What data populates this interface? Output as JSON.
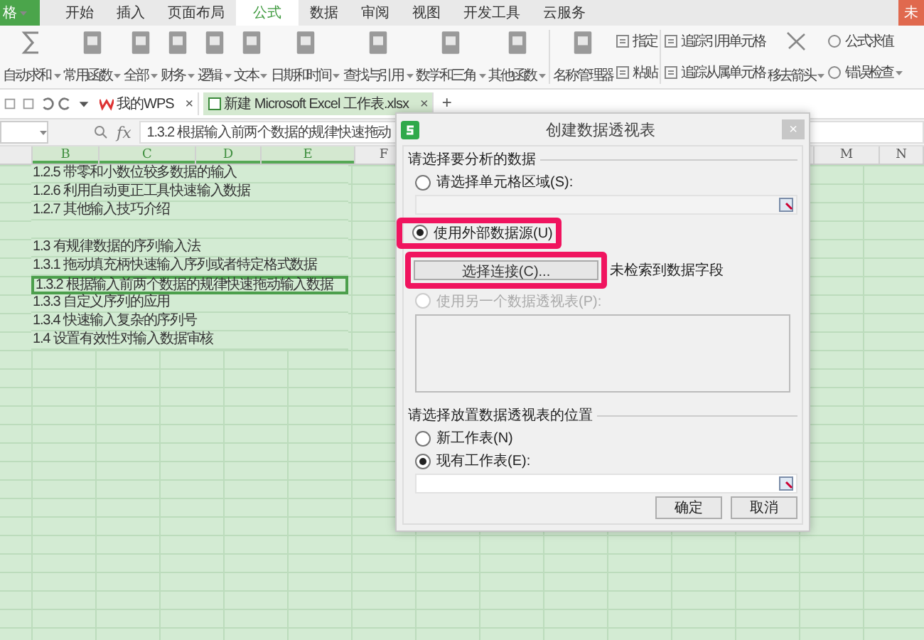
{
  "app_button": {
    "label": "格"
  },
  "menu_tabs": [
    {
      "label": "开始",
      "selected": false
    },
    {
      "label": "插入",
      "selected": false
    },
    {
      "label": "页面布局",
      "selected": false
    },
    {
      "label": "公式",
      "selected": true
    },
    {
      "label": "数据",
      "selected": false
    },
    {
      "label": "审阅",
      "selected": false
    },
    {
      "label": "视图",
      "selected": false
    },
    {
      "label": "开发工具",
      "selected": false
    },
    {
      "label": "云服务",
      "selected": false
    }
  ],
  "account_button": {
    "label": "未"
  },
  "ribbon": {
    "functions": [
      {
        "label": "自动求和",
        "dropdown": true
      },
      {
        "label": "常用函数",
        "dropdown": true
      },
      {
        "label": "全部",
        "dropdown": true
      },
      {
        "label": "财务",
        "dropdown": true
      },
      {
        "label": "逻辑",
        "dropdown": true
      },
      {
        "label": "文本",
        "dropdown": true
      },
      {
        "label": "日期和时间",
        "dropdown": true
      },
      {
        "label": "查找与引用",
        "dropdown": true
      },
      {
        "label": "数学和三角",
        "dropdown": true
      },
      {
        "label": "其他函数",
        "dropdown": true
      }
    ],
    "names": {
      "label": "名称管理器"
    },
    "name_actions": [
      {
        "label": "指定"
      },
      {
        "label": "粘贴"
      }
    ],
    "trace": [
      {
        "label": "追踪引用单元格"
      },
      {
        "label": "追踪从属单元格"
      }
    ],
    "remove_arrows": {
      "label": "移去箭头",
      "dropdown": true
    },
    "audit": [
      {
        "label": "公式求值",
        "dropdown": false
      },
      {
        "label": "错误检查",
        "dropdown": true
      }
    ]
  },
  "doc_tabs": [
    {
      "label": "我的WPS",
      "selected": false,
      "close": "×"
    },
    {
      "label": "新建 Microsoft Excel 工作表.xlsx",
      "selected": true,
      "close": "×"
    }
  ],
  "new_tab": "+",
  "formula_bar": {
    "fx": "fx",
    "value": "1.3.2 根据输入前两个数据的规律快速拖动"
  },
  "columns": [
    {
      "label": "B",
      "selected": true
    },
    {
      "label": "C",
      "selected": true
    },
    {
      "label": "D",
      "selected": true
    },
    {
      "label": "E",
      "selected": true
    },
    {
      "label": "F",
      "selected": false
    },
    {
      "label": "M",
      "selected": false
    },
    {
      "label": "N",
      "selected": false
    }
  ],
  "rows": [
    {
      "text": "1.2.5 带零和小数位较多数据的输入",
      "selected": false
    },
    {
      "text": "1.2.6 利用自动更正工具快速输入数据",
      "selected": false
    },
    {
      "text": "1.2.7 其他输入技巧介绍",
      "selected": false
    },
    {
      "text": "",
      "selected": false
    },
    {
      "text": "1.3 有规律数据的序列输入法",
      "selected": false
    },
    {
      "text": "1.3.1 拖动填充柄快速输入序列或者特定格式数据",
      "selected": false
    },
    {
      "text": "1.3.2 根据输入前两个数据的规律快速拖动输入数据",
      "selected": true
    },
    {
      "text": "1.3.3 自定义序列的应用",
      "selected": false
    },
    {
      "text": "1.3.4 快速输入复杂的序列号",
      "selected": false
    },
    {
      "text": "1.4 设置有效性对输入数据审核",
      "selected": false
    }
  ],
  "dialog": {
    "title": "创建数据透视表",
    "close": "×",
    "source_heading": "请选择要分析的数据",
    "source_options": [
      {
        "label": "请选择单元格区域(S):",
        "selected": false,
        "disabled": false,
        "highlighted": false
      },
      {
        "label": "使用外部数据源(U)",
        "selected": true,
        "disabled": false,
        "highlighted": true
      },
      {
        "label": "使用另一个数据透视表(P):",
        "selected": false,
        "disabled": true,
        "highlighted": false
      }
    ],
    "connection_button": {
      "label": "选择连接(C)...",
      "highlighted": true
    },
    "connection_note": "未检索到数据字段",
    "location_heading": "请选择放置数据透视表的位置",
    "location_options": [
      {
        "label": "新工作表(N)",
        "selected": false
      },
      {
        "label": "现有工作表(E):",
        "selected": true
      }
    ],
    "buttons": [
      "确定",
      "取消"
    ]
  }
}
